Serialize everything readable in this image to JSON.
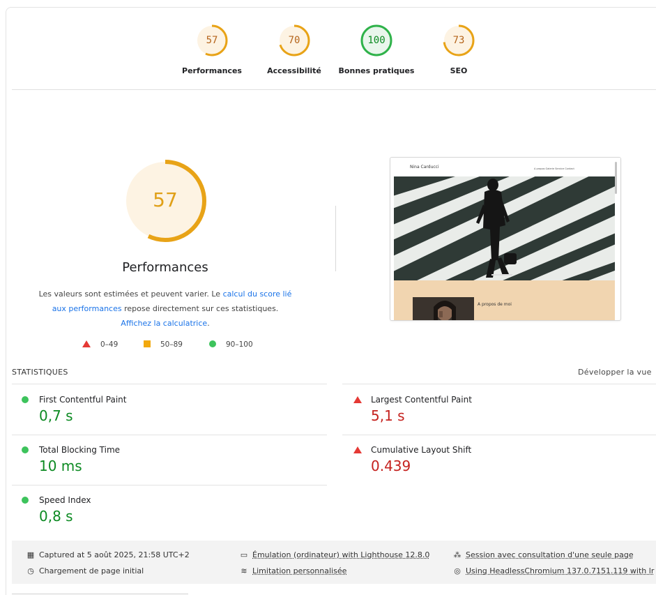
{
  "summary": [
    {
      "score": "57",
      "label": "Performances",
      "fraction": 0.57,
      "color": "#e8a317",
      "bg": "#fdf3e3",
      "text_color": "#b5641a"
    },
    {
      "score": "70",
      "label": "Accessibilité",
      "fraction": 0.7,
      "color": "#e8a317",
      "bg": "#fdf3e3",
      "text_color": "#b5641a"
    },
    {
      "score": "100",
      "label": "Bonnes pratiques",
      "fraction": 1.0,
      "color": "#2fb24a",
      "bg": "#e9f6ec",
      "text_color": "#0c8a22"
    },
    {
      "score": "73",
      "label": "SEO",
      "fraction": 0.73,
      "color": "#e8a317",
      "bg": "#fdf3e3",
      "text_color": "#b5641a"
    }
  ],
  "main": {
    "score": "57",
    "fraction": 0.57,
    "title": "Performances",
    "desc_before": "Les valeurs sont estimées et peuvent varier. Le ",
    "desc_link1": "calcul du score lié aux performances",
    "desc_middle": " repose directement sur ces statistiques. ",
    "desc_link2": "Affichez la calculatrice",
    "desc_end": "."
  },
  "legend": {
    "fail": "0–49",
    "average": "50–89",
    "pass": "90–100"
  },
  "thumbnail": {
    "site_name": "Nina Carducci",
    "menu": "A propos   Galerie   Service   Contact",
    "about": "A propos de moi"
  },
  "stats": {
    "heading": "STATISTIQUES",
    "expand": "Développer la vue",
    "metrics": [
      {
        "name": "First Contentful Paint",
        "value": "0,7 s",
        "status": "pass"
      },
      {
        "name": "Largest Contentful Paint",
        "value": "5,1 s",
        "status": "fail"
      },
      {
        "name": "Total Blocking Time",
        "value": "10 ms",
        "status": "pass"
      },
      {
        "name": "Cumulative Layout Shift",
        "value": "0.439",
        "status": "fail"
      },
      {
        "name": "Speed Index",
        "value": "0,8 s",
        "status": "pass"
      }
    ]
  },
  "footer": {
    "captured": "Captured at 5 août 2025, 21:58 UTC+2",
    "emulation": "Émulation (ordinateur) with Lighthouse 12.8.0",
    "session": "Session avec consultation d'une seule page",
    "load": "Chargement de page initial",
    "throttle": "Limitation personnalisée",
    "browser": "Using HeadlessChromium 137.0.7151.119 with lr"
  },
  "icons": {
    "calendar": "calendar-icon",
    "laptop": "laptop-icon",
    "people": "people-icon",
    "timer": "timer-icon",
    "wifi": "wifi-icon",
    "chrome": "chrome-icon"
  }
}
